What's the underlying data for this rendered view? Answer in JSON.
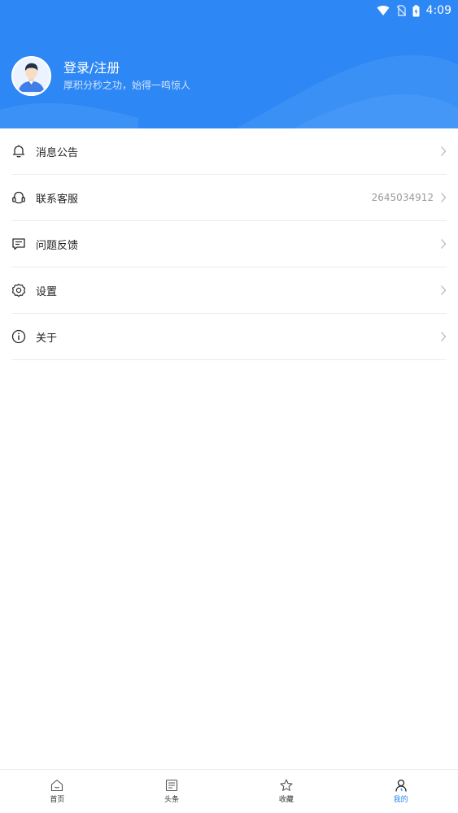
{
  "status_bar": {
    "time": "4:09",
    "icons": [
      "wifi-icon",
      "no-sim-icon",
      "battery-charging-icon"
    ]
  },
  "profile": {
    "title": "登录/注册",
    "subtitle": "厚积分秒之功，始得一鸣惊人",
    "avatar": "avatar"
  },
  "menu": [
    {
      "icon": "bell-icon",
      "label": "消息公告",
      "value": ""
    },
    {
      "icon": "customer-service-icon",
      "label": "联系客服",
      "value": "2645034912"
    },
    {
      "icon": "feedback-icon",
      "label": "问题反馈",
      "value": ""
    },
    {
      "icon": "settings-icon",
      "label": "设置",
      "value": ""
    },
    {
      "icon": "info-icon",
      "label": "关于",
      "value": ""
    }
  ],
  "bottom_nav": [
    {
      "icon": "home-icon",
      "label": "首页",
      "active": false
    },
    {
      "icon": "news-icon",
      "label": "头条",
      "active": false
    },
    {
      "icon": "star-icon",
      "label": "收藏",
      "active": false
    },
    {
      "icon": "user-icon",
      "label": "我的",
      "active": true
    }
  ],
  "colors": {
    "primary": "#2d87f5",
    "active_tab": "#2d87f5"
  }
}
